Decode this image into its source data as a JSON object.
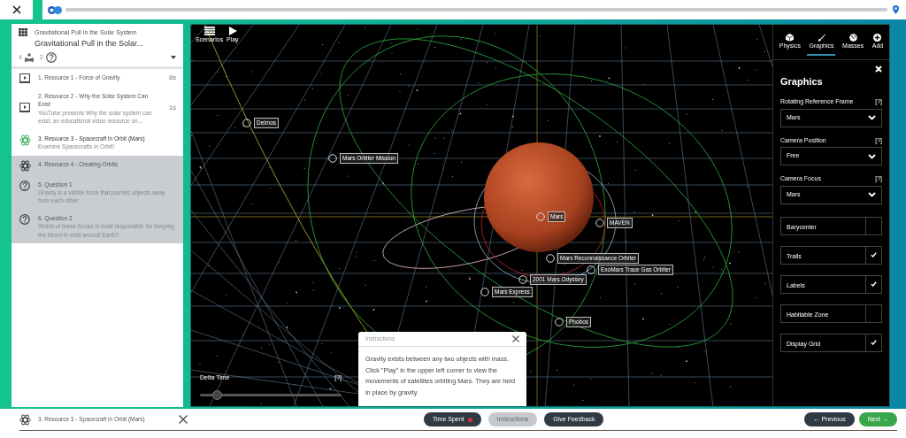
{
  "sidebar": {
    "subtitle": "Gravitational Pull in the Solar System",
    "title": "Gravitational Pull in the Solar...",
    "resource_count": "4",
    "question_count": "2",
    "items": [
      {
        "kind": "video",
        "title": "1. Resource 1 - Force of Gravity",
        "time": "8s",
        "selected": false,
        "shaded": false
      },
      {
        "kind": "video",
        "title": "2. Resource 2 - Why the Solar System Can Exist",
        "description": "YouTube presents Why the solar system can exist, an educational video resource on...",
        "time": "1s",
        "selected": false,
        "shaded": false
      },
      {
        "kind": "simulation",
        "title": "3. Resource 3 - Spacecraft in Orbit (Mars)",
        "description": "Examine Spacecrafts in Orbit!",
        "selected": true,
        "shaded": false
      },
      {
        "kind": "simulation",
        "title": "4. Resource 4 - Creating Orbits",
        "selected": false,
        "shaded": true
      },
      {
        "kind": "question",
        "title": "5. Question 1",
        "description": "Gravity is a visible force that pushes objects away from each other.",
        "selected": false,
        "shaded": true
      },
      {
        "kind": "question",
        "title": "6. Question 2",
        "description": "Which of these forces is most responsible for keeping the Moon in orbit around Earth?",
        "selected": false,
        "shaded": true
      }
    ]
  },
  "simulation": {
    "toolbar": [
      "Scenarios",
      "Play"
    ],
    "labels": [
      "Deimos",
      "Mars Orbiter Mission",
      "Mars",
      "MAVEN",
      "Mars Reconnaissance Orbiter",
      "ExoMars Trace Gas Orbiter",
      "2001 Mars Odyssey",
      "Mars Express",
      "Phobos"
    ],
    "delta_time": {
      "label": "Delta Time",
      "help": "[?]",
      "level": 0.12
    },
    "instructions": {
      "title": "Instructions",
      "text": "Gravity exists between any two objects with mass. Click \"Play\" in the upper left corner to view the movements of satellites orbiting Mars. They are held in place by gravity."
    }
  },
  "panel": {
    "tabs": [
      {
        "label": "Physics",
        "selected": false
      },
      {
        "label": "Graphics",
        "selected": true
      },
      {
        "label": "Masses",
        "selected": false
      },
      {
        "label": "Add",
        "selected": false
      }
    ],
    "title": "Graphics",
    "selects": [
      {
        "label": "Rotating Reference Frame",
        "help": "[?]",
        "value": "Mars"
      },
      {
        "label": "Camera Position",
        "help": "[?]",
        "value": "Free"
      },
      {
        "label": "Camera Focus",
        "help": "[?]",
        "value": "Mars"
      }
    ],
    "toggles": [
      {
        "label": "Barycenter",
        "checked": false
      },
      {
        "label": "Trails",
        "checked": true
      },
      {
        "label": "Labels",
        "checked": true
      },
      {
        "label": "Habitable Zone",
        "checked": false
      },
      {
        "label": "Display Grid",
        "checked": true
      }
    ]
  },
  "bottom_bar": {
    "current": "3. Resource 3 - Spacecraft in Orbit (Mars)",
    "buttons": [
      {
        "label": "Time Spent",
        "disabled": false,
        "dot": true
      },
      {
        "label": "Instructions",
        "disabled": true,
        "dot": false
      },
      {
        "label": "Give Feedback",
        "disabled": false,
        "dot": false
      }
    ],
    "previous": "← Previous",
    "next": "Next →"
  }
}
